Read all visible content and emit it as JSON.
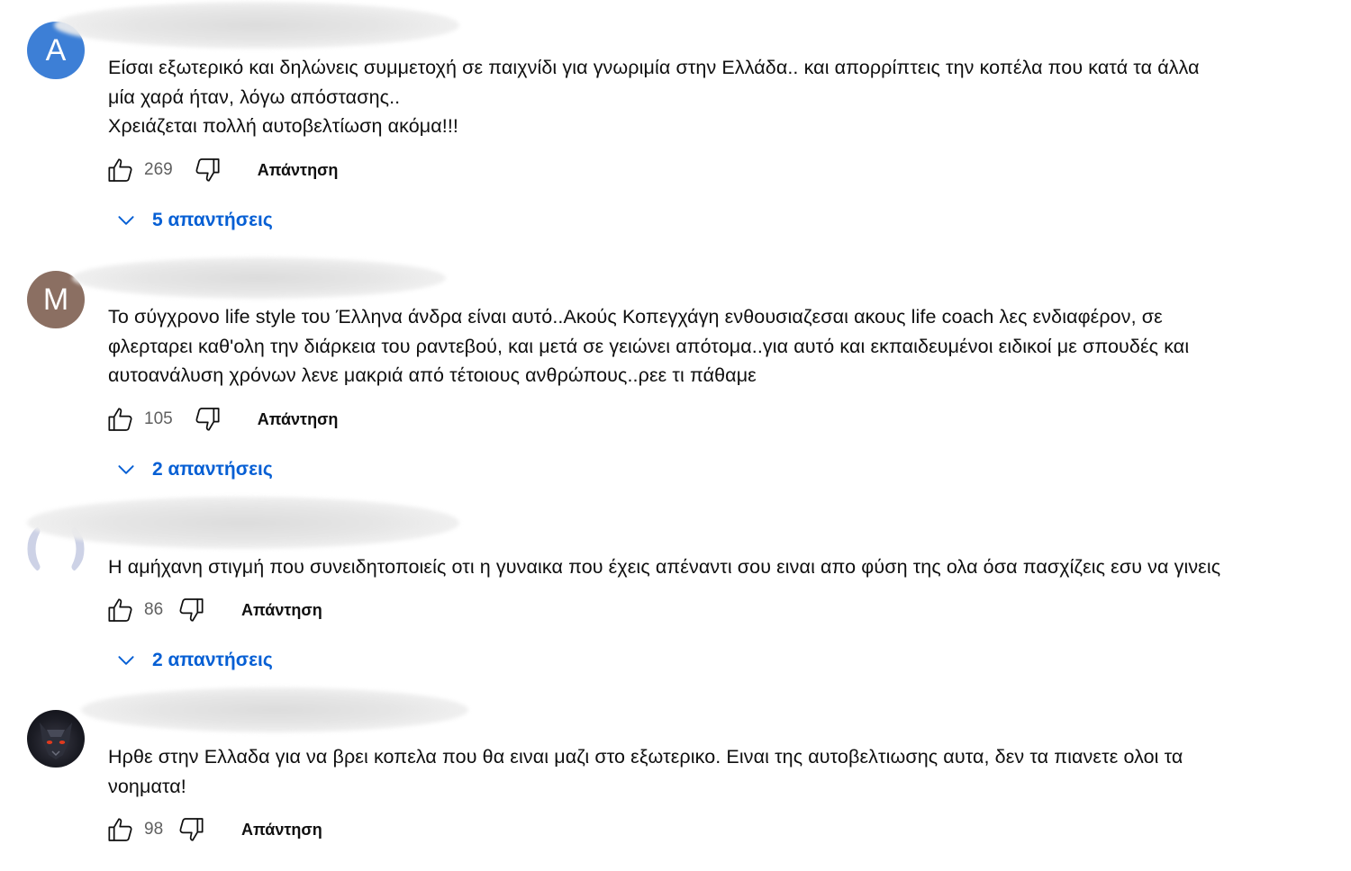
{
  "colors": {
    "link_blue": "#065fd4",
    "text": "#0f0f0f",
    "secondary_text": "#606060",
    "avatar_a": "#3d7fd6",
    "avatar_m": "#8b6f62"
  },
  "comments": [
    {
      "avatar_letter": "A",
      "text": "Είσαι εξωτερικό και δηλώνεις συμμετοχή σε παιχνίδι για γνωριμία στην Ελλάδα.. και απορρίπτεις την κοπέλα που κατά τα άλλα\nμία χαρά ήταν, λόγω απόστασης..\nΧρειάζεται πολλή αυτοβελτίωση ακόμα!!!",
      "likes": "269",
      "reply_label": "Απάντηση",
      "replies_label": "5 απαντήσεις"
    },
    {
      "avatar_letter": "M",
      "text": "Το σύγχρονο life style του Έλληνα άνδρα είναι αυτό..Ακούς Κοπεγχάγη ενθουσιαζεσαι ακους life coach λες ενδιαφέρον, σε\nφλερταρει καθ'ολη την διάρκεια του ραντεβού, και μετά σε γειώνει απότομα..για αυτό και εκπαιδευμένοι ειδικοί με σπουδές και\nαυτοανάλυση χρόνων λενε μακριά από τέτοιους ανθρώπους..ρεε τι πάθαμε",
      "likes": "105",
      "reply_label": "Απάντηση",
      "replies_label": "2 απαντήσεις"
    },
    {
      "text": "Η αμήχανη στιγμή που συνειδητοποιείς οτι η γυναικα που έχεις απέναντι σου ειναι απο φύση της ολα όσα πασχίζεις εσυ να γινεις",
      "likes": "86",
      "reply_label": "Απάντηση",
      "replies_label": "2 απαντήσεις"
    },
    {
      "text": "Ηρθε στην Ελλαδα για να βρει κοπελα που θα ειναι μαζι στο εξωτερικο. Ειναι της αυτοβελτιωσης αυτα, δεν τα πιανετε ολοι τα\nνοηματα!",
      "likes": "98",
      "reply_label": "Απάντηση"
    }
  ]
}
